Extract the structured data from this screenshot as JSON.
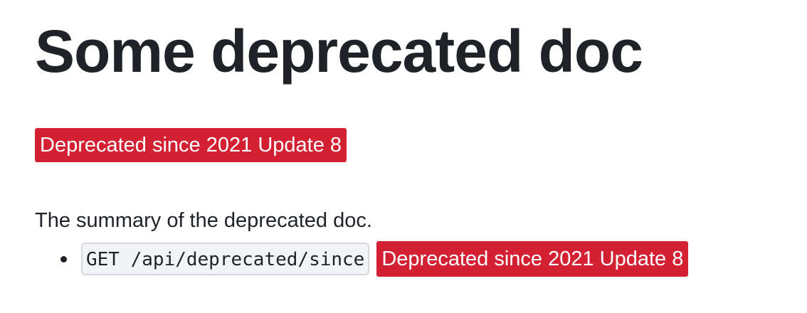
{
  "doc": {
    "title": "Some deprecated doc",
    "deprecation_badge": "Deprecated since 2021 Update 8",
    "summary": "The summary of the deprecated doc."
  },
  "endpoints": [
    {
      "code": "GET /api/deprecated/since",
      "badge": "Deprecated since 2021 Update 8"
    }
  ],
  "colors": {
    "badge_background": "#d42033",
    "badge_text": "#ffffff",
    "text": "#1f2328",
    "code_background": "#f3f4f6",
    "code_border": "#d5d8dd"
  }
}
